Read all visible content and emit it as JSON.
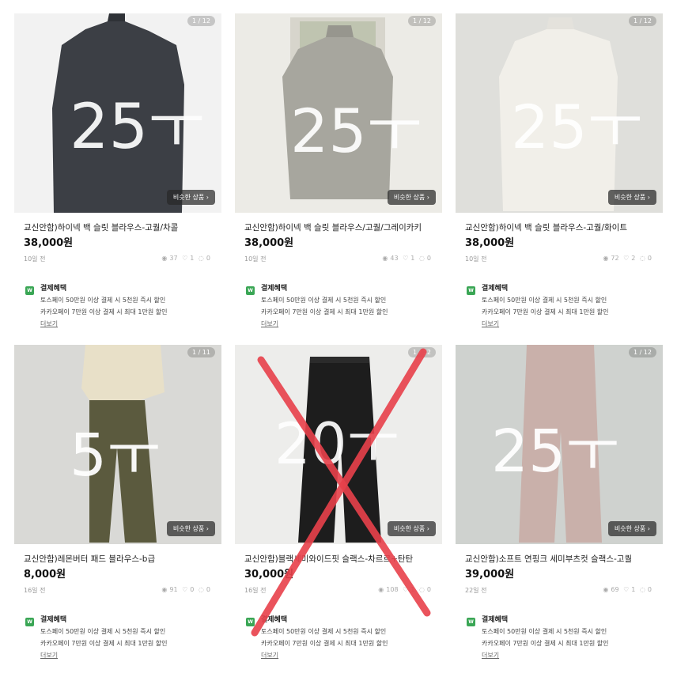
{
  "benefit": {
    "title": "결제혜택",
    "icon": "W",
    "line1": "토스페이 50만원 이상 결제 시 5천원 즉시 할인",
    "line2": "카카오페이 7만원 이상 결제 시 최대 1만원 할인",
    "more": "더보기"
  },
  "similar_label": "비슷한 상품 ›",
  "products": [
    {
      "counter": "1 / 12",
      "title": "교신안함)하이넥 백 슬릿 블라우스-고퀄/차콜",
      "price": "38,000원",
      "ago": "10일 전",
      "views": "37",
      "likes": "1",
      "chats": "0",
      "overlay": "25ㅜ",
      "color": "#3c3f45"
    },
    {
      "counter": "1 / 12",
      "title": "교신안함)하이넥 백 슬릿 블라우스/고퀄/그레이카키",
      "price": "38,000원",
      "ago": "10일 전",
      "views": "43",
      "likes": "1",
      "chats": "0",
      "overlay": "25ㅜ",
      "color": "#a7a69e"
    },
    {
      "counter": "1 / 12",
      "title": "교신안함)하이넥 백 슬릿 블라우스-고퀄/화이트",
      "price": "38,000원",
      "ago": "10일 전",
      "views": "72",
      "likes": "2",
      "chats": "0",
      "overlay": "25ㅜ",
      "color": "#f1efe9"
    },
    {
      "counter": "1 / 11",
      "title": "교신안함)레몬버터 패드 블라우스-b급",
      "price": "8,000원",
      "ago": "16일 전",
      "views": "91",
      "likes": "0",
      "chats": "0",
      "overlay": "5ㅜ",
      "color": "#5b5a3e"
    },
    {
      "counter": "1 / 12",
      "title": "교신안함)블랙세미와이드핏 슬랙스-차르르+탄탄",
      "price": "30,000원",
      "ago": "16일 전",
      "views": "108",
      "likes": "1",
      "chats": "0",
      "overlay": "20ㅜ",
      "color": "#1d1d1d"
    },
    {
      "counter": "1 / 12",
      "title": "교신안함)소프트 연핑크 세미부츠컷 슬랙스-고퀄",
      "price": "39,000원",
      "ago": "22일 전",
      "views": "69",
      "likes": "1",
      "chats": "0",
      "overlay": "25ㅜ",
      "color": "#c9b0aa"
    }
  ],
  "colors": {
    "strike": "#e8414b",
    "benefit_icon": "#3aa655"
  },
  "sold_marker": {
    "product_index": 4,
    "icon": "red-x-mark"
  }
}
